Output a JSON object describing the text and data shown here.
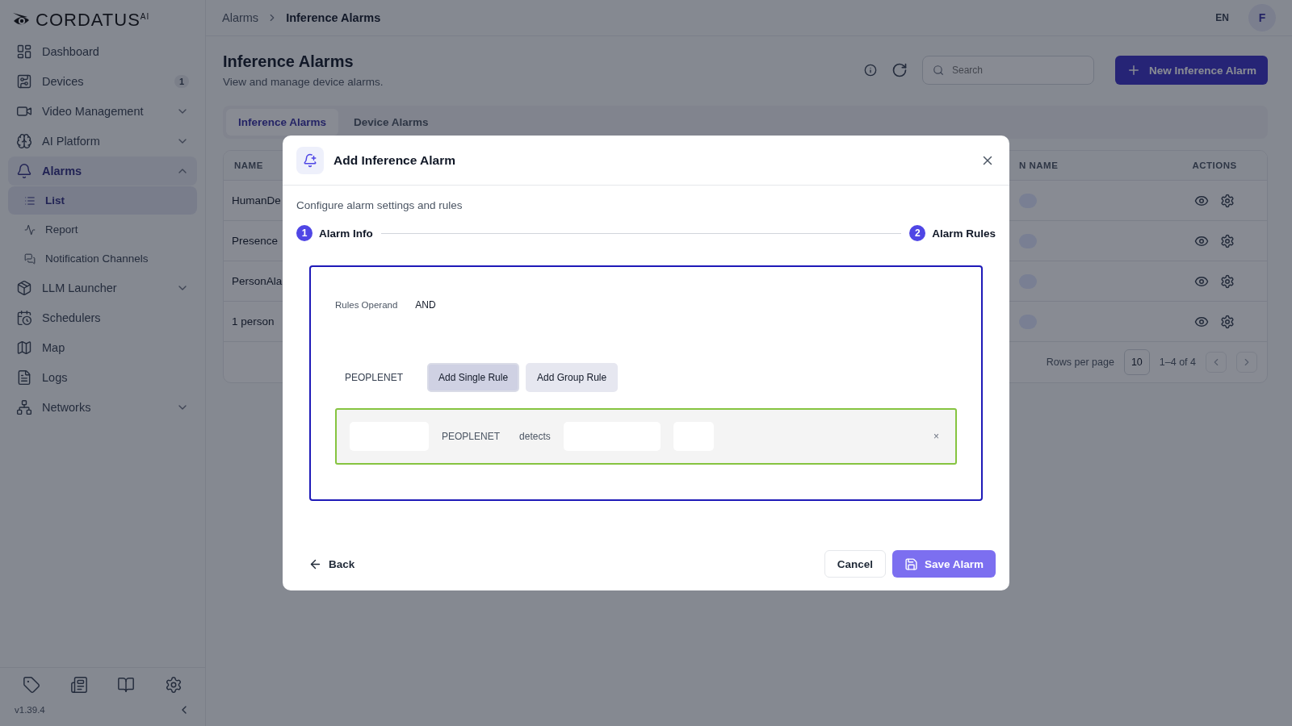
{
  "logo": {
    "text": "CORDATUS$^{AI}$"
  },
  "sidebar": {
    "items": [
      {
        "label": "Dashboard",
        "selected": false
      },
      {
        "label": "Devices",
        "selected": false,
        "badge": "1"
      },
      {
        "label": "Video Management",
        "selected": false,
        "expanded": false
      },
      {
        "label": "AI Platform",
        "selected": false,
        "expanded": false
      },
      {
        "label": "Alarms",
        "selected": true,
        "expanded": true,
        "children": [
          {
            "label": "List",
            "selected": true
          },
          {
            "label": "Report",
            "selected": false
          },
          {
            "label": "Notification Channels",
            "selected": false
          }
        ]
      },
      {
        "label": "LLM Launcher",
        "selected": false,
        "expanded": false
      },
      {
        "label": "Schedulers",
        "selected": false
      },
      {
        "label": "Map",
        "selected": false
      },
      {
        "label": "Logs",
        "selected": false
      },
      {
        "label": "Networks",
        "selected": false,
        "expanded": false
      }
    ],
    "version": "v1.39.4"
  },
  "breadcrumb": [
    "Alarms",
    "Inference Alarms"
  ],
  "topbar": {
    "language": "EN",
    "avatar": "F"
  },
  "page": {
    "title": "Inference Alarms",
    "subtitle": "View and manage device alarms.",
    "search": {
      "placeholder": "Search"
    },
    "new_button": "New Inference Alarm"
  },
  "tabs": [
    {
      "label": "Inference Alarms",
      "selected": true
    },
    {
      "label": "Device Alarms",
      "selected": false
    }
  ],
  "table": {
    "columns": [
      "NAME",
      "N NAME",
      "ACTIONS"
    ],
    "rows": [
      {
        "name": "HumanDe"
      },
      {
        "name": "Presence"
      },
      {
        "name": "PersonAla"
      },
      {
        "name": "1 person"
      }
    ],
    "rows_per_page_label": "Rows per page",
    "rows_per_page": "10",
    "range": "1–4 of 4"
  },
  "dialog": {
    "title": "Add Inference Alarm",
    "description": "Configure alarm settings and rules",
    "steps": [
      {
        "number": "1",
        "label": "Alarm Info"
      },
      {
        "number": "2",
        "label": "Alarm Rules"
      }
    ],
    "rules": {
      "operand_label": "Rules Operand",
      "operand": "AND",
      "model": "PEOPLENET",
      "add_buttons": [
        {
          "label": "Add Single Rule",
          "selected": true
        },
        {
          "label": "Add Group Rule",
          "selected": false
        }
      ],
      "rule": {
        "model": "PEOPLENET",
        "verb": "detects",
        "remove": "×"
      }
    },
    "back": "Back",
    "cancel": "Cancel",
    "save": "Save Alarm"
  }
}
